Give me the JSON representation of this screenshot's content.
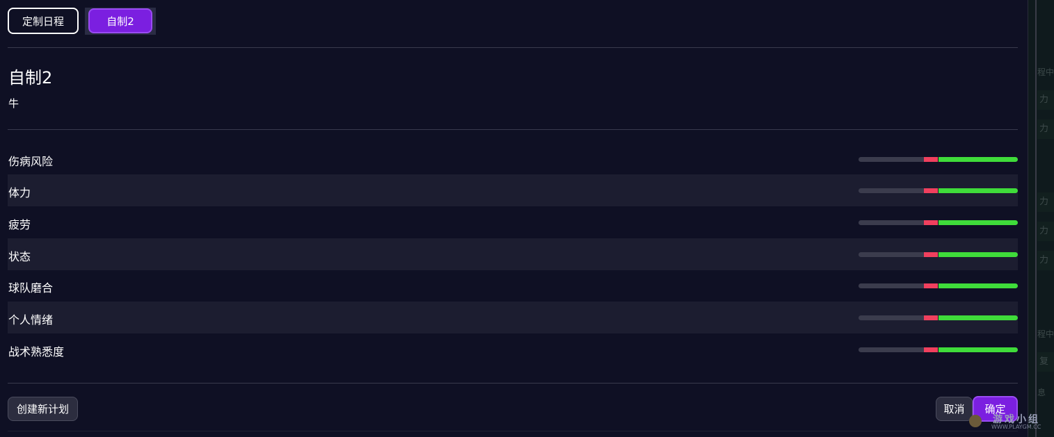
{
  "tabs": [
    {
      "label": "定制日程",
      "selected": false
    },
    {
      "label": "自制2",
      "selected": true
    }
  ],
  "plan": {
    "title": "自制2",
    "subtitle": "牛"
  },
  "attributes": [
    {
      "label": "伤病风险"
    },
    {
      "label": "体力"
    },
    {
      "label": "疲劳"
    },
    {
      "label": "状态"
    },
    {
      "label": "球队磨合"
    },
    {
      "label": "个人情绪"
    },
    {
      "label": "战术熟悉度"
    }
  ],
  "buttons": {
    "create": "创建新计划",
    "cancel": "取消",
    "ok": "确定"
  },
  "side_panel": {
    "texts": [
      "程中",
      "力",
      "力",
      "力",
      "力",
      "力",
      "程中",
      "复",
      "息"
    ]
  },
  "watermark": {
    "name": "游戏小组",
    "url": "WWW.PLAYGM.CC"
  },
  "colors": {
    "background": "#0f1024",
    "accent": "#7b1fe0",
    "negative": "#f0405e",
    "positive": "#3fdc3a"
  }
}
